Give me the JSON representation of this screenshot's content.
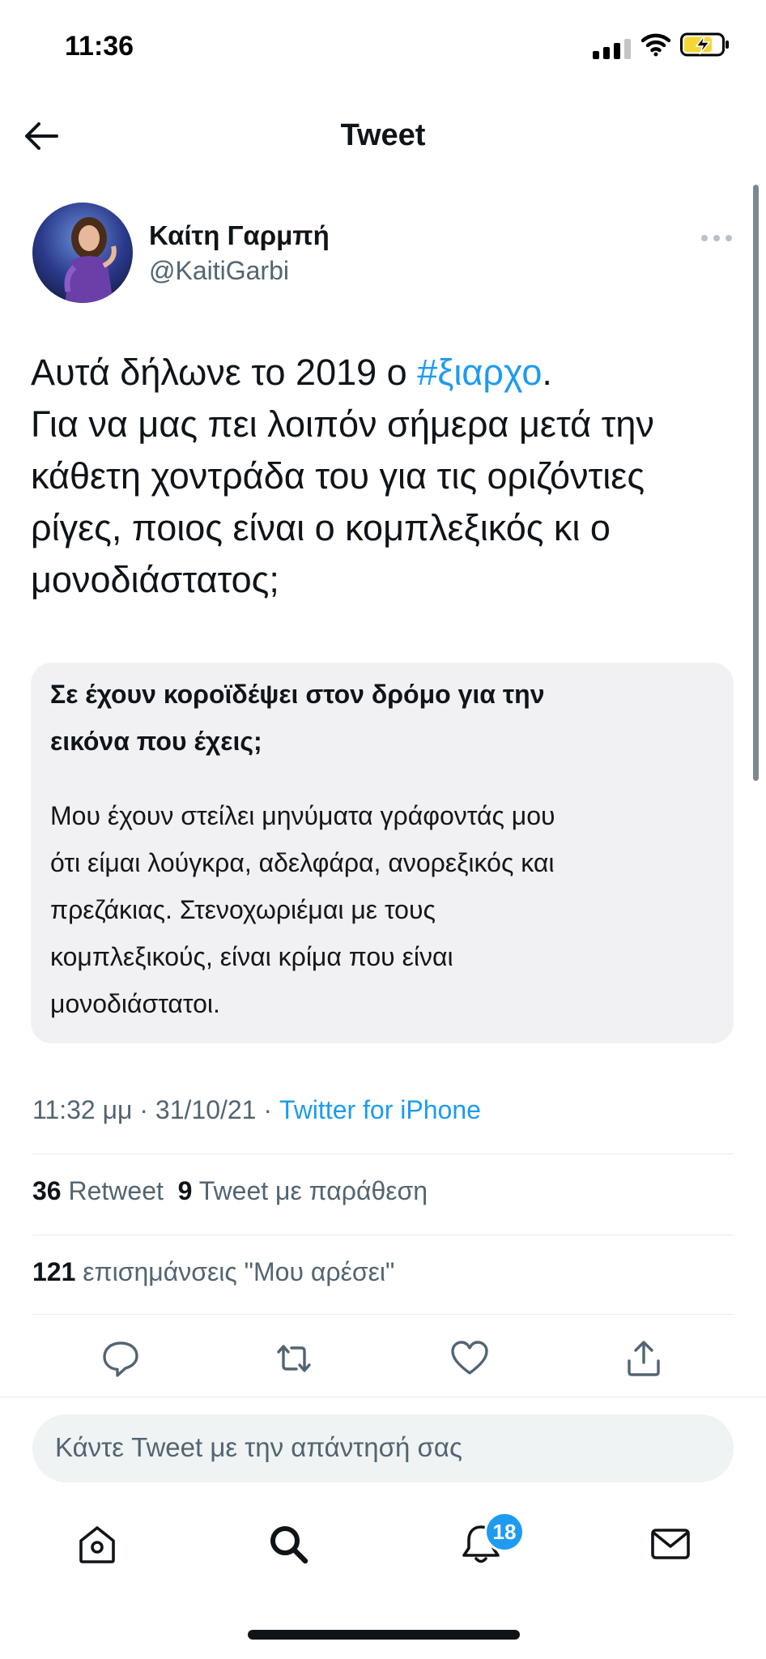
{
  "status_bar": {
    "time": "11:36"
  },
  "header": {
    "title": "Tweet"
  },
  "author": {
    "name": "Καίτη Γαρμπή",
    "handle": "@KaitiGarbi"
  },
  "tweet": {
    "line1_prefix": "Αυτά δήλωνε το 2019 ο ",
    "hashtag": "#ξιαρχο",
    "line1_suffix": ".",
    "lines": [
      "Για να μας πει λοιπόν σήμερα μετά την",
      "κάθετη χοντράδα του για τις οριζόντιες",
      "ρίγες, ποιος είναι ο κομπλεξικός κι ο",
      "μονοδιάστατος;"
    ]
  },
  "quote": {
    "heading_lines": [
      "Σε έχουν κοροϊδέψει στον δρόμο για την",
      "εικόνα που έχεις;"
    ],
    "body_lines": [
      "Μου έχουν στείλει μηνύματα γράφοντάς μου",
      "ότι είμαι λούγκρα, αδελφάρα, ανορεξικός και",
      "πρεζάκιας. Στενοχωριέμαι με τους",
      "κομπλεξικούς, είναι κρίμα που είναι",
      "μονοδιάστατοι."
    ]
  },
  "meta": {
    "time": "11:32 μμ",
    "sep1": " · ",
    "date": "31/10/21",
    "sep2": " · ",
    "source": "Twitter for iPhone"
  },
  "stats": {
    "retweets": "36",
    "retweets_label": " Retweet  ",
    "quotes": "9",
    "quotes_label": " Tweet με παράθεση",
    "likes": "121",
    "likes_label": " επισημάνσεις \"Μου αρέσει\""
  },
  "actions": [
    "reply-icon",
    "retweet-icon",
    "like-icon",
    "share-icon"
  ],
  "reply_box": {
    "placeholder": "Κάντε Tweet με την απάντησή σας"
  },
  "tab_bar": {
    "items": [
      "home-icon",
      "search-icon",
      "notifications-icon",
      "messages-icon"
    ],
    "notification_badge": "18"
  },
  "colors": {
    "accent": "#1d9bf0",
    "text": "#0f1419",
    "muted": "#536471",
    "quote_bg": "#f1f1f3"
  }
}
